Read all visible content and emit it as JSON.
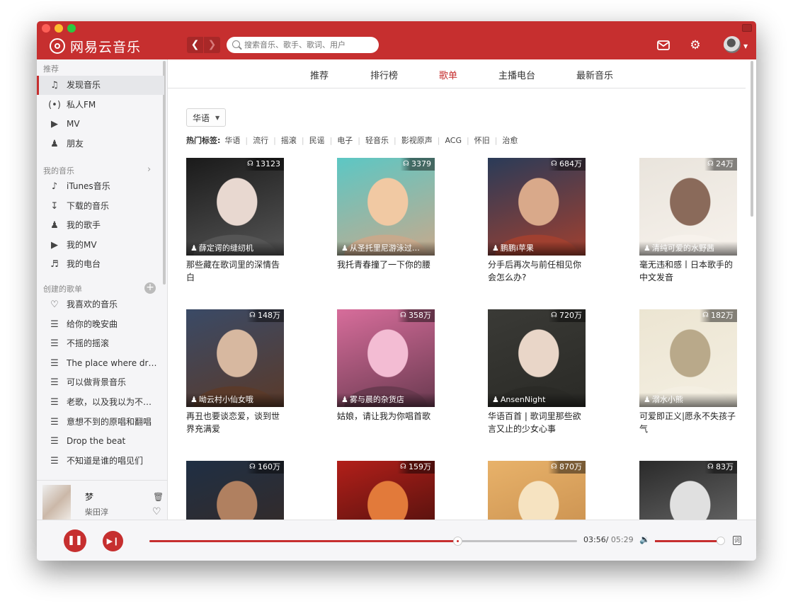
{
  "app": {
    "title": "网易云音乐"
  },
  "search": {
    "placeholder": "搜索音乐、歌手、歌词、用户"
  },
  "colors": {
    "accent": "#c62f2f",
    "sidebar_bg": "#f5f5f7"
  },
  "nav_tabs": [
    {
      "label": "推荐",
      "active": false
    },
    {
      "label": "排行榜",
      "active": false
    },
    {
      "label": "歌单",
      "active": true
    },
    {
      "label": "主播电台",
      "active": false
    },
    {
      "label": "最新音乐",
      "active": false
    }
  ],
  "sidebar": {
    "sections": {
      "recommend": "推荐",
      "my_music": "我的音乐",
      "created": "创建的歌单"
    },
    "recommend_items": [
      {
        "label": "发现音乐",
        "icon": "music-note-icon",
        "active": true
      },
      {
        "label": "私人FM",
        "icon": "radio-wave-icon"
      },
      {
        "label": "MV",
        "icon": "video-icon"
      },
      {
        "label": "朋友",
        "icon": "friends-icon"
      }
    ],
    "my_music_items": [
      {
        "label": "iTunes音乐",
        "icon": "itunes-icon"
      },
      {
        "label": "下载的音乐",
        "icon": "download-icon"
      },
      {
        "label": "我的歌手",
        "icon": "singer-icon"
      },
      {
        "label": "我的MV",
        "icon": "video-icon"
      },
      {
        "label": "我的电台",
        "icon": "radio-icon"
      }
    ],
    "playlists": [
      {
        "label": "我喜欢的音乐",
        "icon": "heart-icon"
      },
      {
        "label": "给你的晚安曲",
        "icon": "playlist-icon"
      },
      {
        "label": "不摇的摇滚",
        "icon": "playlist-icon"
      },
      {
        "label": "The place where drug…",
        "icon": "playlist-icon"
      },
      {
        "label": "可以做背景音乐",
        "icon": "playlist-icon"
      },
      {
        "label": "老歌，以及我以为不…",
        "icon": "playlist-icon"
      },
      {
        "label": "意想不到的原唱和翻唱",
        "icon": "playlist-icon"
      },
      {
        "label": "Drop the beat",
        "icon": "playlist-icon"
      },
      {
        "label": "不知道是谁的唱见们",
        "icon": "playlist-icon"
      }
    ]
  },
  "now_playing": {
    "title": "梦",
    "artist": "柴田淳"
  },
  "category": {
    "selected": "华语"
  },
  "hot_tags": {
    "label": "热门标签:",
    "tags": [
      "华语",
      "流行",
      "摇滚",
      "民谣",
      "电子",
      "轻音乐",
      "影视原声",
      "ACG",
      "怀旧",
      "治愈"
    ]
  },
  "playlists_grid": [
    {
      "count": "13123",
      "creator": "薛定谔的缝纫机",
      "title": "那些藏在歌词里的深情告白",
      "colors": [
        "#1a1a1a",
        "#e8d8d0",
        "#555"
      ]
    },
    {
      "count": "3379",
      "creator": "从圣托里尼游泳过…",
      "title": "我托青春撞了一下你的腰",
      "colors": [
        "#5cc7c4",
        "#f1c9a3",
        "#c7a98c"
      ]
    },
    {
      "count": "684万",
      "creator": "鹏鹏i苹果",
      "title": "分手后再次与前任相见你会怎么办?",
      "colors": [
        "#2a3b58",
        "#d9a98a",
        "#a04030"
      ]
    },
    {
      "count": "24万",
      "creator": "清纯可爱的水野茜",
      "title": "毫无违和感丨日本歌手的中文发音",
      "colors": [
        "#e9e4dc",
        "#8a6a5a",
        "#f7f2ec"
      ]
    },
    {
      "count": "148万",
      "creator": "呦云村小仙女哦",
      "title": "再丑也要谈恋爱，谈到世界充满爱",
      "colors": [
        "#3a4a66",
        "#d7b8a0",
        "#5a3a2a"
      ]
    },
    {
      "count": "358万",
      "creator": "雾与晨的杂货店",
      "title": "姑娘，请让我为你唱首歌",
      "colors": [
        "#d76d9b",
        "#f3bcd3",
        "#6a3a50"
      ]
    },
    {
      "count": "720万",
      "creator": "AnsenNight",
      "title": "华语百首 | 歌词里那些欲言又止的少女心事",
      "colors": [
        "#3a3a36",
        "#e9d6c8",
        "#2a2a26"
      ]
    },
    {
      "count": "182万",
      "creator": "溺水小熊",
      "title": "可爱即正义|愿永不失孩子气",
      "colors": [
        "#ece5d2",
        "#b9a98a",
        "#f4efe2"
      ]
    },
    {
      "count": "160万",
      "creator": "",
      "title": "",
      "colors": [
        "#1f2f44",
        "#b08060",
        "#3a2a22"
      ]
    },
    {
      "count": "159万",
      "creator": "",
      "title": "",
      "colors": [
        "#b21f1a",
        "#e27a3a",
        "#3a0e0a"
      ]
    },
    {
      "count": "870万",
      "creator": "",
      "title": "",
      "colors": [
        "#e8b26a",
        "#f6e3c1",
        "#c48a4a"
      ]
    },
    {
      "count": "83万",
      "creator": "",
      "title": "",
      "colors": [
        "#2a2a2a",
        "#e0e0e0",
        "#777"
      ]
    }
  ],
  "player": {
    "current_time": "03:56/",
    "total_time": " 05:29",
    "progress": 0.72,
    "volume": 0.97,
    "playlist_icon_text": "词"
  }
}
